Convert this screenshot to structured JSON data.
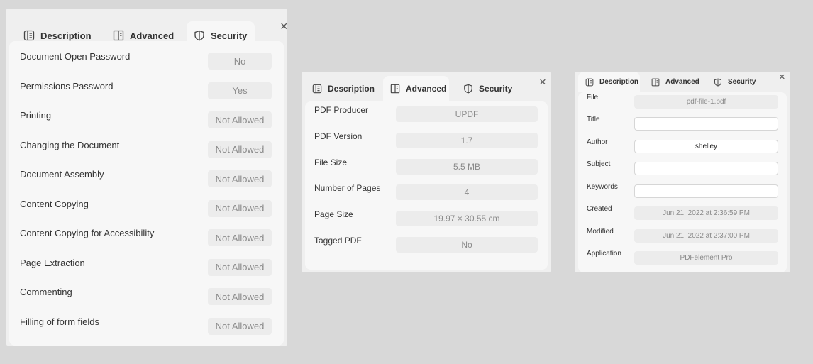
{
  "tabs": {
    "description": "Description",
    "advanced": "Advanced",
    "security": "Security"
  },
  "close_icon": "×",
  "security_panel": {
    "rows": [
      {
        "label": "Document Open Password",
        "value": "No"
      },
      {
        "label": "Permissions Password",
        "value": "Yes"
      },
      {
        "label": "Printing",
        "value": "Not Allowed"
      },
      {
        "label": "Changing the Document",
        "value": "Not Allowed"
      },
      {
        "label": "Document Assembly",
        "value": "Not Allowed"
      },
      {
        "label": "Content Copying",
        "value": "Not Allowed"
      },
      {
        "label": "Content Copying for Accessibility",
        "value": "Not Allowed"
      },
      {
        "label": "Page Extraction",
        "value": "Not Allowed"
      },
      {
        "label": "Commenting",
        "value": "Not Allowed"
      },
      {
        "label": "Filling of form fields",
        "value": "Not Allowed"
      }
    ]
  },
  "advanced_panel": {
    "rows": [
      {
        "label": "PDF Producer",
        "value": "UPDF"
      },
      {
        "label": "PDF Version",
        "value": "1.7"
      },
      {
        "label": "File Size",
        "value": "5.5 MB"
      },
      {
        "label": "Number of Pages",
        "value": "4"
      },
      {
        "label": "Page Size",
        "value": "19.97 × 30.55 cm"
      },
      {
        "label": "Tagged PDF",
        "value": "No"
      }
    ]
  },
  "description_panel": {
    "rows": [
      {
        "label": "File",
        "value": "pdf-file-1.pdf",
        "editable": false
      },
      {
        "label": "Title",
        "value": "",
        "editable": true
      },
      {
        "label": "Author",
        "value": "shelley",
        "editable": true
      },
      {
        "label": "Subject",
        "value": "",
        "editable": true
      },
      {
        "label": "Keywords",
        "value": "",
        "editable": true
      },
      {
        "label": "Created",
        "value": "Jun 21, 2022 at 2:36:59 PM",
        "editable": false
      },
      {
        "label": "Modified",
        "value": "Jun 21, 2022 at 2:37:00 PM",
        "editable": false
      },
      {
        "label": "Application",
        "value": "PDFelement Pro",
        "editable": false
      }
    ]
  }
}
